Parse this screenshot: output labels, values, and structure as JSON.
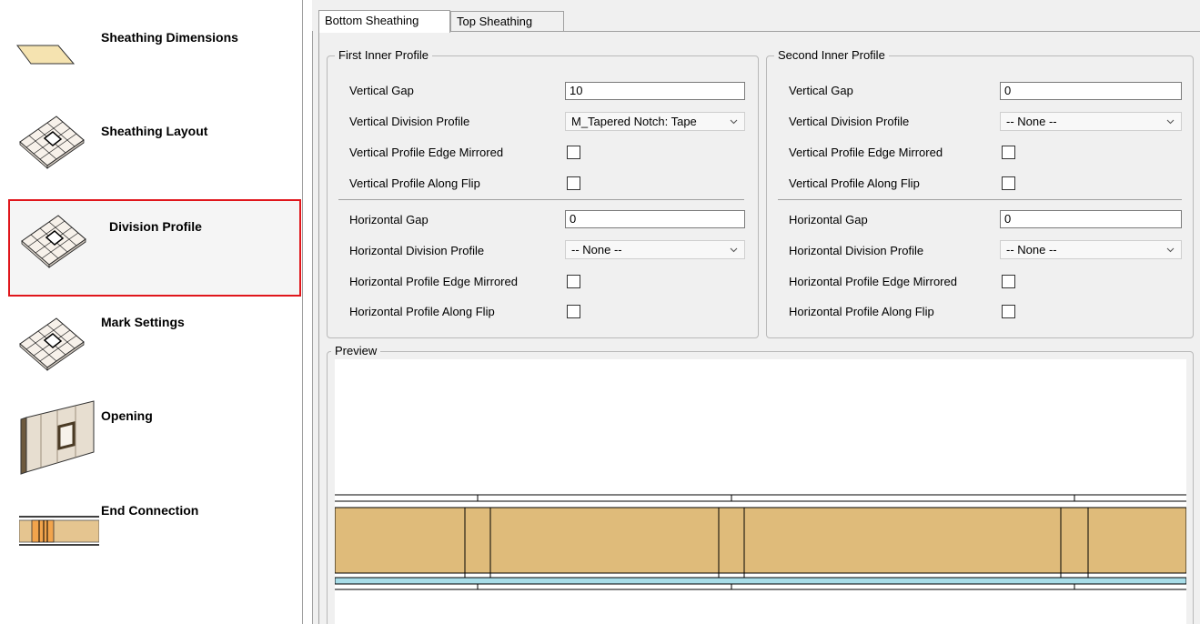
{
  "nav": {
    "items": [
      {
        "label": "Sheathing Dimensions",
        "icon": "sheathing-dimensions-icon"
      },
      {
        "label": "Sheathing Layout",
        "icon": "sheathing-layout-icon"
      },
      {
        "label": "Division Profile",
        "icon": "division-profile-icon",
        "selected": true
      },
      {
        "label": "Mark Settings",
        "icon": "mark-settings-icon"
      },
      {
        "label": "Opening",
        "icon": "opening-icon"
      },
      {
        "label": "End Connection",
        "icon": "end-connection-icon"
      }
    ]
  },
  "tabs": [
    {
      "label": "Bottom Sheathing",
      "active": true
    },
    {
      "label": "Top Sheathing",
      "active": false
    }
  ],
  "first": {
    "legend": "First Inner Profile",
    "vertical_gap_label": "Vertical Gap",
    "vertical_gap_value": "10",
    "vertical_division_label": "Vertical Division Profile",
    "vertical_division_value": "M_Tapered Notch: Tape",
    "vertical_edge_mirrored_label": "Vertical Profile Edge Mirrored",
    "vertical_along_flip_label": "Vertical Profile Along Flip",
    "horizontal_gap_label": "Horizontal Gap",
    "horizontal_gap_value": "0",
    "horizontal_division_label": "Horizontal Division Profile",
    "horizontal_division_value": "-- None --",
    "horizontal_edge_mirrored_label": "Horizontal Profile Edge Mirrored",
    "horizontal_along_flip_label": "Horizontal Profile Along Flip"
  },
  "second": {
    "legend": "Second Inner Profile",
    "vertical_gap_label": "Vertical Gap",
    "vertical_gap_value": "0",
    "vertical_division_label": "Vertical Division Profile",
    "vertical_division_value": "-- None --",
    "vertical_edge_mirrored_label": "Vertical Profile Edge Mirrored",
    "vertical_along_flip_label": "Vertical Profile Along Flip",
    "horizontal_gap_label": "Horizontal Gap",
    "horizontal_gap_value": "0",
    "horizontal_division_label": "Horizontal Division Profile",
    "horizontal_division_value": "-- None --",
    "horizontal_edge_mirrored_label": "Horizontal Profile Edge Mirrored",
    "horizontal_along_flip_label": "Horizontal Profile Along Flip"
  },
  "preview": {
    "legend": "Preview",
    "colors": {
      "sheathing": "#dfbb7a",
      "membrane": "#a8dde8",
      "line": "#000000"
    }
  }
}
